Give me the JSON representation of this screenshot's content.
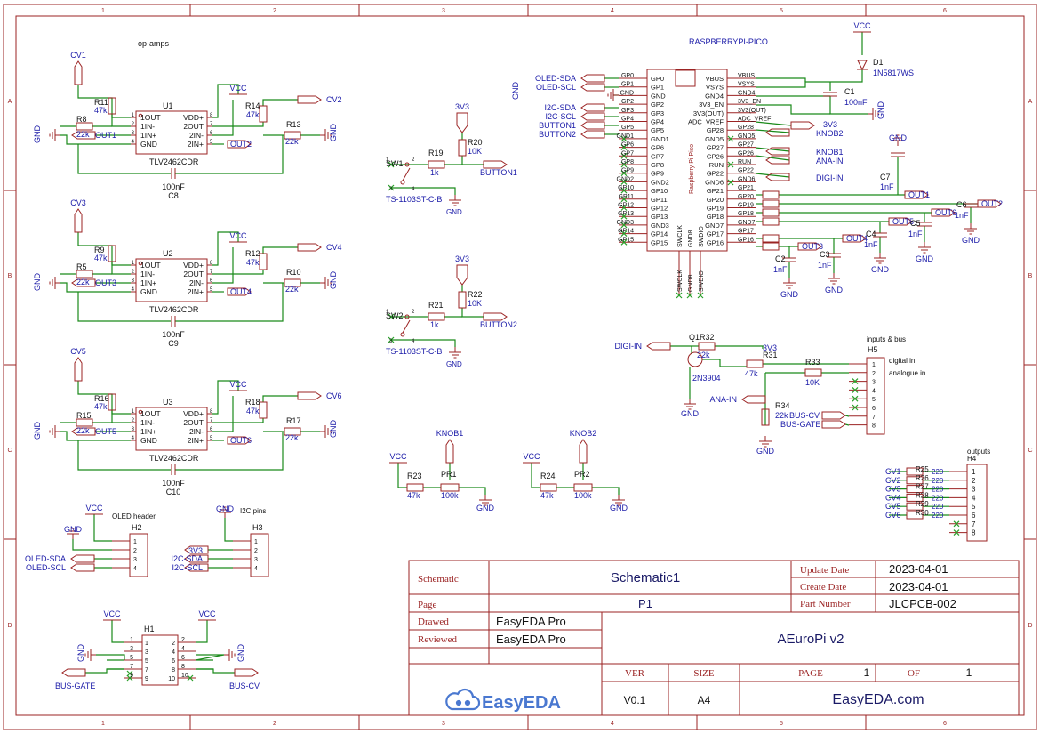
{
  "colors": {
    "frame": "#9b2323",
    "wire": "#1a8a1a",
    "label": "#1a1aa8",
    "text": "#111111",
    "nc": "#2aa02a",
    "easyeda": "#4a78d0"
  },
  "border": {
    "cols": [
      "1",
      "2",
      "3",
      "4",
      "5",
      "6"
    ],
    "rows": [
      "A",
      "B",
      "C",
      "D"
    ]
  },
  "sections": {
    "opamps": "op-amps",
    "oled": "OLED header",
    "i2c": "I2C pins",
    "inputs": "inputs & bus",
    "outputs": "outputs"
  },
  "opamps": [
    {
      "cv": "CV1",
      "r_in": "R8",
      "r_in_val": "22k",
      "r_fb": "R11",
      "r_fb_val": "47k",
      "u": "U1",
      "r2_fb": "R14",
      "r2_fb_val": "47k",
      "r_out": "R13",
      "r_out_val": "22k",
      "in_net": "OUT1",
      "in2_net": "OUT2",
      "cv_out": "CV2",
      "cap": "C8",
      "cap_val": "100nF",
      "part": "TLV2462CDR"
    },
    {
      "cv": "CV3",
      "r_in": "R5",
      "r_in_val": "22k",
      "r_fb": "R9",
      "r_fb_val": "47k",
      "u": "U2",
      "r2_fb": "R12",
      "r2_fb_val": "47k",
      "r_out": "R10",
      "r_out_val": "22k",
      "in_net": "OUT3",
      "in2_net": "OUT4",
      "cv_out": "CV4",
      "cap": "C9",
      "cap_val": "100nF",
      "part": "TLV2462CDR"
    },
    {
      "cv": "CV5",
      "r_in": "R15",
      "r_in_val": "22k",
      "r_fb": "R16",
      "r_fb_val": "47k",
      "u": "U3",
      "r2_fb": "R18",
      "r2_fb_val": "47k",
      "r_out": "R17",
      "r_out_val": "22k",
      "in_net": "OUT5",
      "in2_net": "OUT6",
      "cv_out": "CV6",
      "cap": "C10",
      "cap_val": "100nF",
      "part": "TLV2462CDR"
    }
  ],
  "opamp_pins_left": [
    "1OUT",
    "1IN-",
    "1IN+",
    "GND"
  ],
  "opamp_pins_right": [
    "VDD+",
    "2OUT",
    "2IN-",
    "2IN+"
  ],
  "nets": {
    "vcc": "VCC",
    "gnd": "GND",
    "v33": "3V3"
  },
  "buttons": [
    {
      "sw": "SW1",
      "r": "R19",
      "r_val": "1k",
      "pull": "R20",
      "pull_val": "10K",
      "net": "BUTTON1",
      "part": "TS-1103ST-C-B"
    },
    {
      "sw": "SW2",
      "r": "R21",
      "r_val": "1k",
      "pull": "R22",
      "pull_val": "10K",
      "net": "BUTTON2",
      "part": "TS-1103ST-C-B"
    }
  ],
  "pico": {
    "title": "RASPBERRYPI-PICO",
    "body": "Raspberry Pi Pico",
    "left": [
      "GP0",
      "GP1",
      "GND",
      "GP2",
      "GP3",
      "GP4",
      "GP5",
      "GND1",
      "GP6",
      "GP7",
      "GP8",
      "GP9",
      "GND2",
      "GP10",
      "GP11",
      "GP12",
      "GP13",
      "GND3",
      "GP14",
      "GP15"
    ],
    "right": [
      "VBUS",
      "VSYS",
      "GND4",
      "3V3_EN",
      "3V3(OUT)",
      "ADC_VREF",
      "GP28",
      "GND5",
      "GP27",
      "GP26",
      "RUN",
      "GP22",
      "GND6",
      "GP21",
      "GP20",
      "GP19",
      "GP18",
      "GND7",
      "GP17",
      "GP16"
    ],
    "bottom": [
      "SWCLK",
      "GND8",
      "SWDIO"
    ],
    "right_net": [
      "VBUS",
      "VSYS",
      "GND4",
      "3V3_EN",
      "3V3(OUT)",
      "ADC_VREF",
      "GP28",
      "GND5",
      "GP27",
      "GP26",
      "RUN",
      "GP22",
      "GND6",
      "GP21",
      "GP20",
      "GP19",
      "GP18",
      "GND7",
      "GP17",
      "GP16"
    ],
    "left_nets": [
      "OLED-SDA",
      "OLED-SCL",
      "I2C-SDA",
      "I2C-SCL",
      "BUTTON1",
      "BUTTON2"
    ],
    "right_nets": [
      "KNOB2",
      "KNOB1",
      "ANA-IN",
      "DIGI-IN"
    ]
  },
  "power": {
    "d1": "D1",
    "d1_val": "1N5817WS",
    "c1": "C1",
    "c1_val": "100nF"
  },
  "filters": [
    {
      "c": "C7",
      "v": "1nF",
      "net": "OUT1"
    },
    {
      "c": "C6",
      "v": "1nF",
      "net": "OUT2"
    },
    {
      "c": "C5",
      "v": "1nF",
      "net": "OUT6"
    },
    {
      "c": "C4",
      "v": "1nF",
      "net": "OUT5"
    },
    {
      "c": "C3",
      "v": "1nF",
      "net": "OUT4"
    },
    {
      "c": "C2",
      "v": "1nF",
      "net": "OUT3"
    }
  ],
  "digi": {
    "q": "Q1",
    "q_part": "2N3904",
    "r32": "R32",
    "r32_val": "22k",
    "r31": "R31",
    "r31_val": "47k",
    "r33": "R33",
    "r33_val": "10K",
    "r34": "R34",
    "r34_val": "22k",
    "net": "DIGI-IN",
    "ana": "ANA-IN",
    "bus_cv": "BUS-CV",
    "bus_gate": "BUS-GATE",
    "h5": "H5",
    "digital": "digital in",
    "analogue": "analogue in"
  },
  "knobs": [
    {
      "net": "KNOB1",
      "r": "R23",
      "r_val": "47k",
      "p": "PR1",
      "p_val": "100k"
    },
    {
      "net": "KNOB2",
      "r": "R24",
      "r_val": "47k",
      "p": "PR2",
      "p_val": "100k"
    }
  ],
  "outputs_h4": {
    "h": "H4",
    "rows": [
      {
        "cv": "CV1",
        "r": "R25",
        "v": "220"
      },
      {
        "cv": "CV2",
        "r": "R26",
        "v": "220"
      },
      {
        "cv": "CV3",
        "r": "R27",
        "v": "220"
      },
      {
        "cv": "CV4",
        "r": "R28",
        "v": "220"
      },
      {
        "cv": "CV5",
        "r": "R29",
        "v": "220"
      },
      {
        "cv": "CV6",
        "r": "R30",
        "v": "220"
      }
    ]
  },
  "oled_h2": {
    "h": "H2",
    "sda": "OLED-SDA",
    "scl": "OLED-SCL"
  },
  "i2c_h3": {
    "h": "H3",
    "sda": "I2C-SDA",
    "scl": "I2C-SCL"
  },
  "h1": {
    "h": "H1",
    "gate": "BUS-GATE",
    "cv": "BUS-CV"
  },
  "titleblock": {
    "schematic_label": "Schematic",
    "schematic": "Schematic1",
    "page_label": "Page",
    "page": "P1",
    "drawed_label": "Drawed",
    "drawed": "EasyEDA Pro",
    "reviewed_label": "Reviewed",
    "reviewed": "EasyEDA Pro",
    "update_label": "Update Date",
    "update": "2023-04-01",
    "create_label": "Create Date",
    "create": "2023-04-01",
    "part_label": "Part Number",
    "part": "JLCPCB-002",
    "project": "AEuroPi v2",
    "ver_label": "VER",
    "ver": "V0.1",
    "size_label": "SIZE",
    "size": "A4",
    "pagec_label": "PAGE",
    "pagec": "1",
    "of_label": "OF",
    "of": "1",
    "brand": "EasyEDA",
    "url": "EasyEDA.com"
  }
}
